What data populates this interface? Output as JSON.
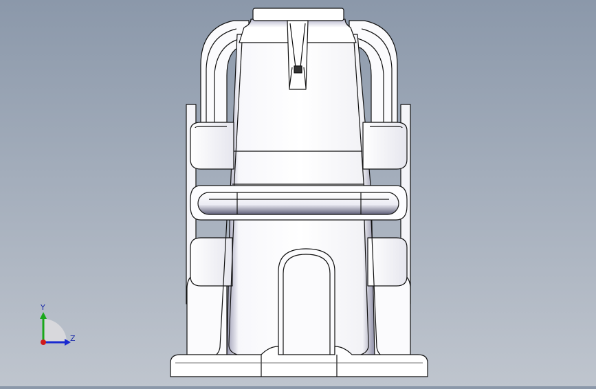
{
  "triad": {
    "y_label": "Y",
    "z_label": "Z",
    "colors": {
      "y": "#1aa81a",
      "z": "#1a2ad0",
      "x": "#d01a1a"
    }
  },
  "model": {
    "view": "side",
    "icon": "cad-part-icon"
  }
}
